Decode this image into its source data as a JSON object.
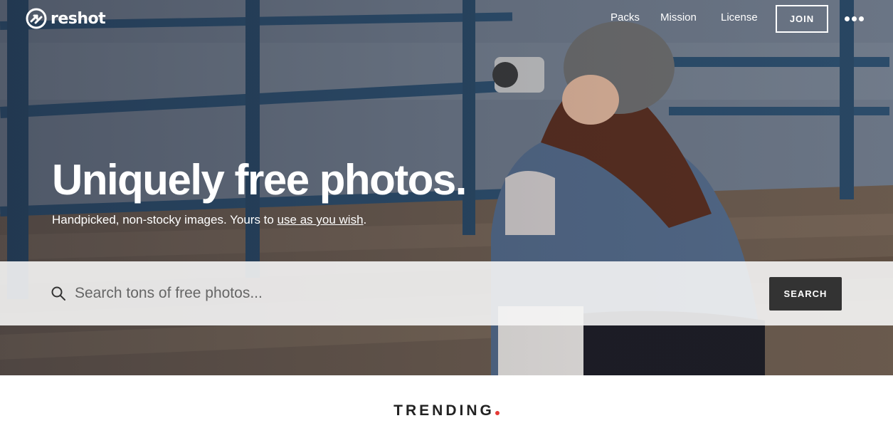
{
  "header": {
    "brand": "reshot",
    "nav": [
      {
        "label": "Packs"
      },
      {
        "label": "Mission"
      },
      {
        "label": "License"
      }
    ],
    "join_label": "JOIN",
    "more_icon": "more-dots-icon"
  },
  "hero": {
    "title": "Uniquely free photos.",
    "subtitle_prefix": "Handpicked, non-stocky images. Yours to ",
    "subtitle_link": "use as you wish",
    "subtitle_suffix": "."
  },
  "search": {
    "placeholder": "Search tons of free photos...",
    "button_label": "SEARCH",
    "icon": "search-icon"
  },
  "trending": {
    "title": "TRENDING",
    "accent_color": "#e53935"
  }
}
